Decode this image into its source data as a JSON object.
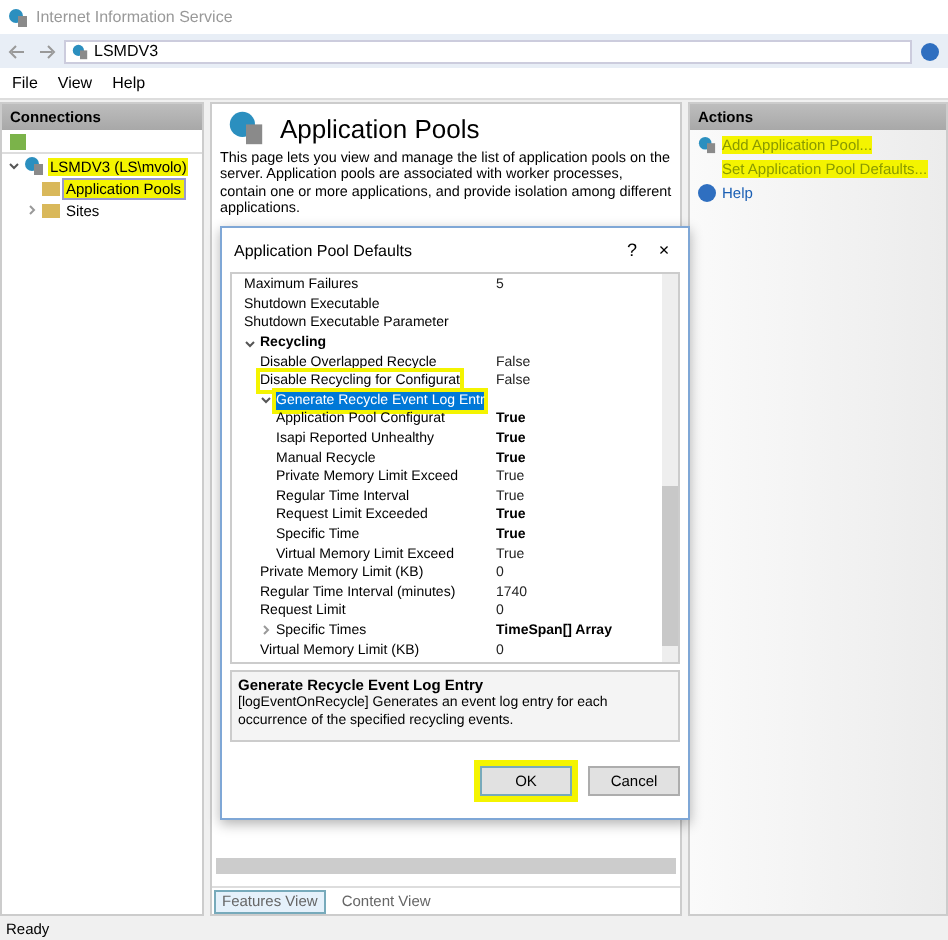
{
  "window": {
    "title": "Internet Information Service"
  },
  "address": {
    "crumb": "LSMDV3"
  },
  "menu": [
    "File",
    "View",
    "Help"
  ],
  "connections": {
    "title": "Connections",
    "tree": [
      {
        "label": "LSMDV3 (LS\\mvolo)",
        "expanded": true,
        "highlighted": true,
        "selected": false,
        "children": [
          {
            "label": "Application Pools",
            "highlighted": true,
            "selected": true
          },
          {
            "label": "Sites",
            "expanded": false,
            "highlighted": false,
            "selected": false
          }
        ]
      }
    ]
  },
  "page": {
    "title": "Application Pools",
    "description": "This page lets you view and manage the list of application pools on the server. Application pools are associated with worker processes, contain one or more applications, and provide isolation among different applications."
  },
  "dialog": {
    "title": "Application Pool Defaults",
    "help": "?",
    "close": "×",
    "properties": [
      {
        "kind": "property",
        "name": "Maximum Failures",
        "value": "5",
        "modified": false
      },
      {
        "kind": "property",
        "name": "Shutdown Executable"
      },
      {
        "kind": "property",
        "name": "Shutdown Executable Parameter"
      },
      {
        "kind": "category",
        "name": "Recycling",
        "expanded": true,
        "children": [
          {
            "kind": "property",
            "name": "Disable Overlapped Recycle",
            "value": "False",
            "modified": false
          },
          {
            "kind": "property",
            "name": "Disable Recycling for Configurat",
            "value": "False",
            "modified": false,
            "highlighted": true
          },
          {
            "kind": "group",
            "name": "Generate Recycle Event Log Entr",
            "expanded": true,
            "selected": true,
            "highlighted": true,
            "children": [
              {
                "kind": "property",
                "name": "Application Pool Configurat",
                "value": "True",
                "modified": true
              },
              {
                "kind": "property",
                "name": "Isapi Reported Unhealthy",
                "value": "True",
                "modified": true
              },
              {
                "kind": "property",
                "name": "Manual Recycle",
                "value": "True",
                "modified": true
              },
              {
                "kind": "property",
                "name": "Private Memory Limit Exceed",
                "value": "True",
                "modified": false
              },
              {
                "kind": "property",
                "name": "Regular Time Interval",
                "value": "True",
                "modified": false
              },
              {
                "kind": "property",
                "name": "Request Limit Exceeded",
                "value": "True",
                "modified": true
              },
              {
                "kind": "property",
                "name": "Specific Time",
                "value": "True",
                "modified": true
              },
              {
                "kind": "property",
                "name": "Virtual Memory Limit Exceed",
                "value": "True",
                "modified": false
              }
            ]
          },
          {
            "kind": "property",
            "name": "Private Memory Limit (KB)",
            "value": "0",
            "modified": false
          },
          {
            "kind": "property",
            "name": "Regular Time Interval (minutes)",
            "value": "1740",
            "modified": false
          },
          {
            "kind": "property",
            "name": "Request Limit",
            "value": "0",
            "modified": false
          },
          {
            "kind": "group",
            "name": "Specific Times",
            "expanded": false,
            "selected": false,
            "value": "TimeSpan[] Array",
            "modified": true
          },
          {
            "kind": "property",
            "name": "Virtual Memory Limit (KB)",
            "value": "0",
            "modified": false
          }
        ]
      }
    ],
    "help_title": "Generate Recycle Event Log Entry",
    "help_text": "[logEventOnRecycle] Generates an event log entry for each occurrence of the specified recycling events.",
    "buttons": [
      {
        "label": "OK",
        "highlighted": true
      },
      {
        "label": "Cancel",
        "highlighted": false
      }
    ]
  },
  "view_tabs": [
    {
      "label": "Features View",
      "selected": true
    },
    {
      "label": "Content View",
      "selected": false
    }
  ],
  "actions": {
    "title": "Actions",
    "items": [
      {
        "label": "Add Application Pool...",
        "highlighted": true
      },
      {
        "label": "Set Application Pool Defaults...",
        "highlighted": true
      },
      {
        "label": "Help",
        "highlighted": false
      }
    ]
  },
  "status_bar": "Ready"
}
